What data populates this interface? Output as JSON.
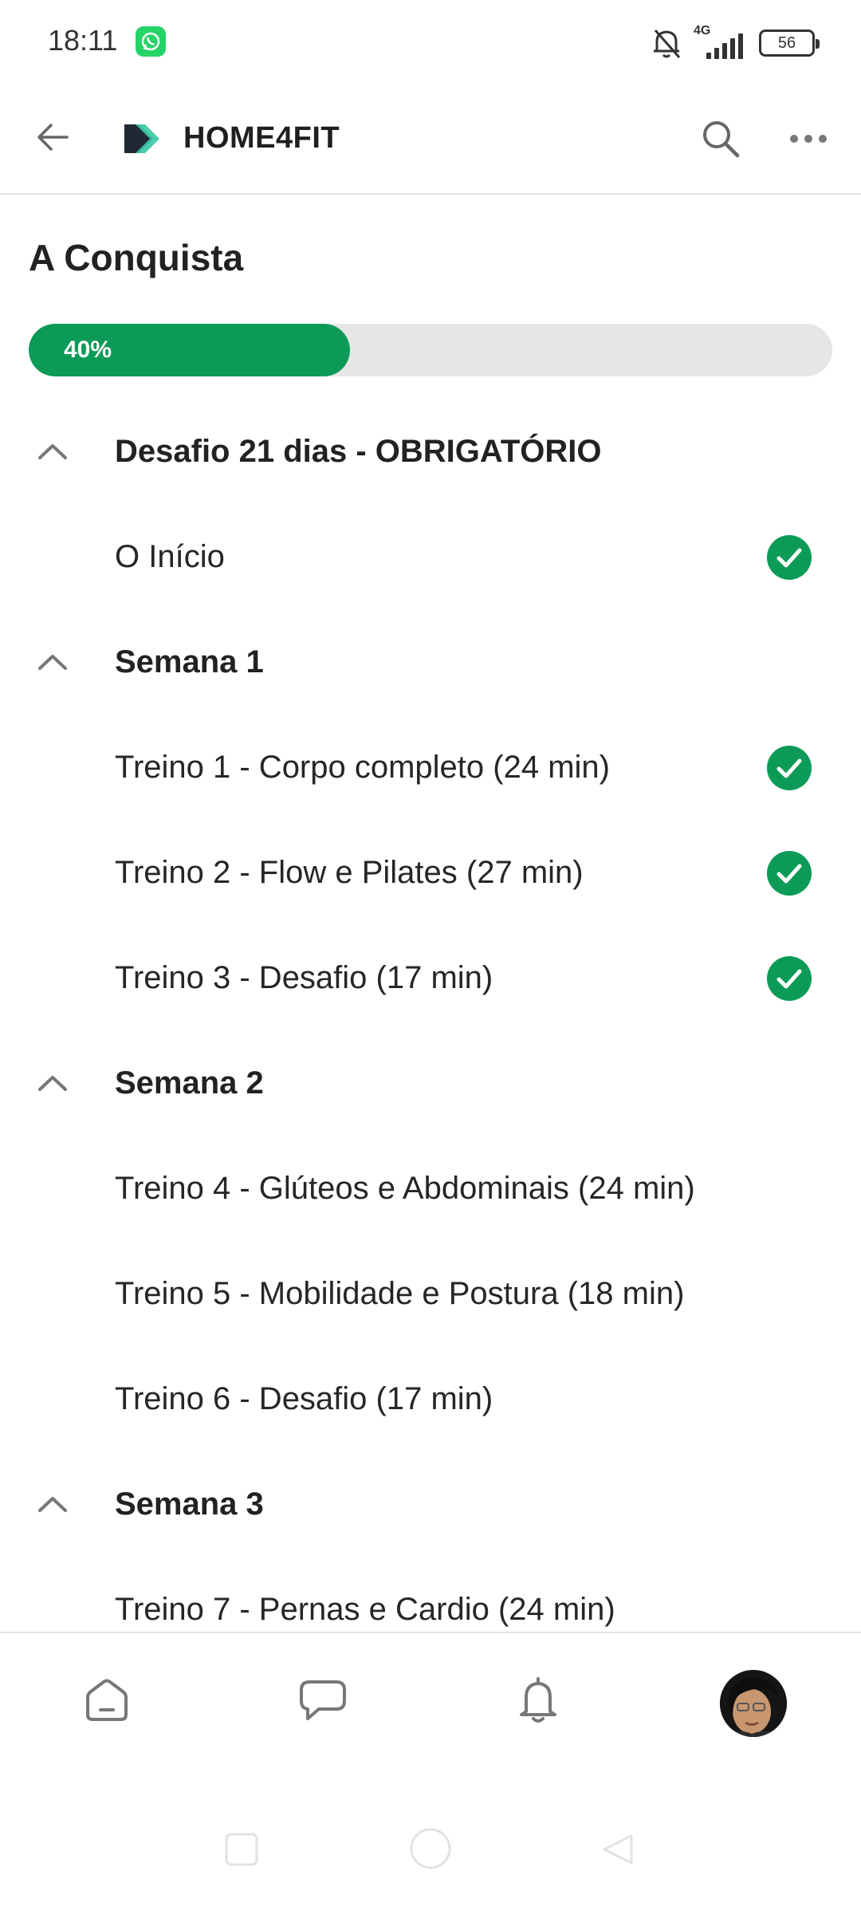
{
  "status_bar": {
    "time": "18:11",
    "network_label": "4G",
    "battery_level": "56",
    "icons": [
      "whatsapp-icon",
      "bell-off-icon",
      "signal-icon",
      "battery-icon"
    ]
  },
  "app_bar": {
    "title": "HOME4FIT",
    "icons": [
      "back-arrow-icon",
      "home4fit-logo",
      "search-icon",
      "more-options-icon"
    ]
  },
  "course": {
    "title": "A Conquista",
    "progress_label": "40%",
    "progress_fraction": 0.4
  },
  "curriculum": {
    "sections": [
      {
        "title": "Desafio 21 dias - OBRIGATÓRIO",
        "expanded": true,
        "lessons": [
          {
            "title": "O Início",
            "completed": true
          }
        ]
      },
      {
        "title": "Semana 1",
        "expanded": true,
        "lessons": [
          {
            "title": "Treino 1 - Corpo completo (24 min)",
            "completed": true
          },
          {
            "title": "Treino 2 - Flow e Pilates (27 min)",
            "completed": true
          },
          {
            "title": "Treino 3 - Desafio (17 min)",
            "completed": true
          }
        ]
      },
      {
        "title": "Semana 2",
        "expanded": true,
        "lessons": [
          {
            "title": "Treino 4 - Glúteos e Abdominais (24 min)",
            "completed": false
          },
          {
            "title": "Treino 5 - Mobilidade e Postura (18 min)",
            "completed": false
          },
          {
            "title": "Treino 6 - Desafio (17 min)",
            "completed": false
          }
        ]
      },
      {
        "title": "Semana 3",
        "expanded": true,
        "lessons": [
          {
            "title": "Treino 7 - Pernas e Cardio (24 min)",
            "completed": false
          }
        ]
      }
    ]
  },
  "bottom_nav": {
    "items": [
      "home-icon",
      "chat-icon",
      "notifications-icon",
      "profile-avatar"
    ]
  },
  "colors": {
    "accent": "#0c9b57",
    "track": "#e6e6e6",
    "text": "#222222",
    "icon_gray": "#777777"
  }
}
